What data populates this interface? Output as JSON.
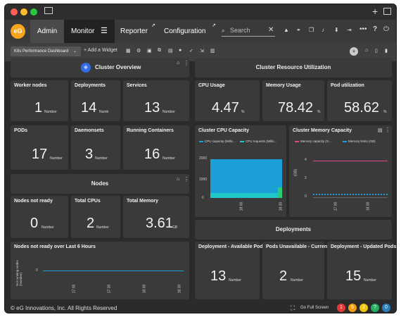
{
  "nav": {
    "tabs": [
      "Admin",
      "Monitor",
      "Reporter",
      "Configuration"
    ],
    "search_placeholder": "Search"
  },
  "toolbar": {
    "dashboard": "K8s Performance Dashboard",
    "add_widget": "+ Add a Widget"
  },
  "sections": {
    "cluster_overview": "Cluster Overview",
    "resource_util": "Cluster Resource Utilization",
    "nodes": "Nodes",
    "deployments": "Deployments"
  },
  "tiles": {
    "worker_nodes": {
      "title": "Worker nodes",
      "value": "1",
      "unit": "Number"
    },
    "deployments": {
      "title": "Deployments",
      "value": "14",
      "unit": "Numb"
    },
    "services": {
      "title": "Services",
      "value": "13",
      "unit": "Number"
    },
    "pods": {
      "title": "PODs",
      "value": "17",
      "unit": "Number"
    },
    "daemonsets": {
      "title": "Daemonsets",
      "value": "3",
      "unit": "Number"
    },
    "running": {
      "title": "Running Containers",
      "value": "16",
      "unit": "Number"
    },
    "cpu_usage": {
      "title": "CPU Usage",
      "value": "4.47",
      "unit": "%"
    },
    "mem_usage": {
      "title": "Memory Usage",
      "value": "78.42",
      "unit": "%"
    },
    "pod_util": {
      "title": "Pod utilization",
      "value": "58.62",
      "unit": "%"
    },
    "not_ready": {
      "title": "Nodes not ready",
      "value": "0",
      "unit": "Number"
    },
    "total_cpus": {
      "title": "Total CPUs",
      "value": "2",
      "unit": "Number"
    },
    "total_mem": {
      "title": "Total Memory",
      "value": "3.61",
      "unit": "GB"
    },
    "dep_avail": {
      "title": "Deployment - Available Pods",
      "value": "13",
      "unit": "Number"
    },
    "pods_unavail": {
      "title": "Pods Unavailable - Current",
      "value": "2",
      "unit": "Number"
    },
    "dep_updated": {
      "title": "Deployment - Updated Pods",
      "value": "15",
      "unit": "Number"
    }
  },
  "charts": {
    "cpu": {
      "title": "Cluster CPU Capacity",
      "legend1": "CPU capacity (Millic...",
      "legend2": "CPU requests (Millic...",
      "y0": "0",
      "y1": "1000",
      "y2": "2000",
      "x1": "18:00",
      "x2": "18:30",
      "color1": "#1aa0d6",
      "color2": "#1fc7c9"
    },
    "mem": {
      "title": "Cluster Memory Capacity",
      "legend1": "Memory capacity (G...",
      "legend2": "Memory limits (GB)",
      "ylabel": "(GB)",
      "y0": "0",
      "y2": "2",
      "y4": "4",
      "x1": "17:00",
      "x2": "18:00",
      "color1": "#e0468c",
      "color2": "#1aa0d6"
    },
    "nodes_nr": {
      "title": "Nodes not ready over Last 6 Hours",
      "ylabel": "Not running nodes (Number)",
      "y0": "0",
      "x": [
        "17:00",
        "17:30",
        "18:00",
        "18:30"
      ]
    }
  },
  "footer": {
    "copyright": "© eG Innovations, Inc. All Rights Reserved",
    "fullscreen": "Go Full Screen",
    "alerts": [
      "1",
      "5",
      "2",
      "0"
    ]
  }
}
